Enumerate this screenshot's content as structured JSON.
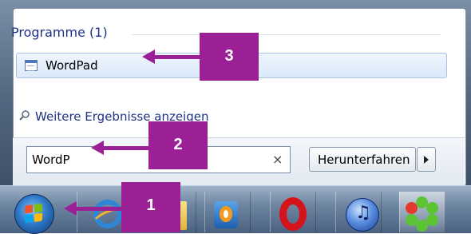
{
  "start_menu": {
    "section_title": "Programme (1)",
    "result_label": "WordPad",
    "more_results": "Weitere Ergebnisse anzeigen",
    "search_value": "WordP",
    "clear_symbol": "×",
    "shutdown_label": "Herunterfahren"
  },
  "annotations": {
    "step1": "1",
    "step2": "2",
    "step3": "3",
    "color": "#9b1f95"
  },
  "taskbar": {
    "icons": [
      "start-orb",
      "internet-explorer-icon",
      "folder-icon",
      "media-player-icon",
      "opera-icon",
      "itunes-icon",
      "icq-icon"
    ]
  }
}
